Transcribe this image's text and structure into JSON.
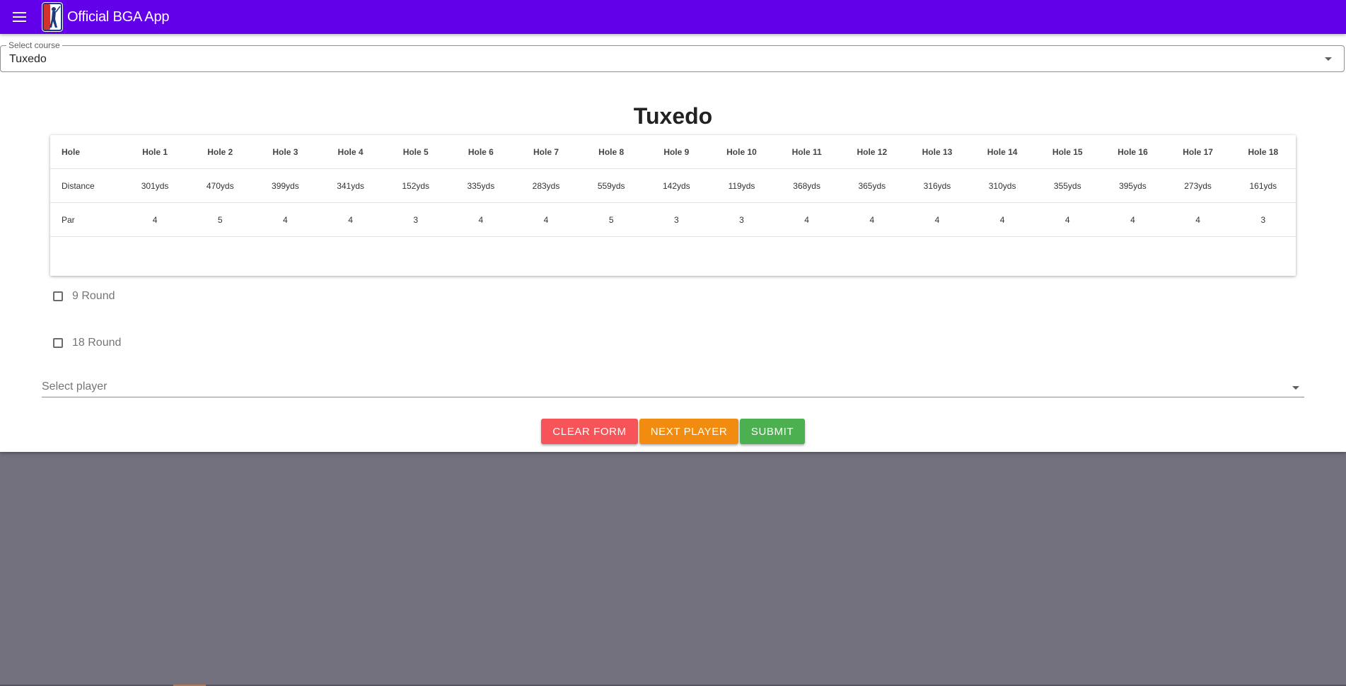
{
  "app": {
    "title": "Official BGA App",
    "theme_color": "#6200ea",
    "background_color": "#72707d",
    "logo": "golfer-logo-icon",
    "menu_icon": "hamburger-menu-icon"
  },
  "course_select": {
    "label": "Select course",
    "value": "Tuxedo"
  },
  "course": {
    "name": "Tuxedo",
    "scorecard": {
      "row_labels": [
        "Hole",
        "Distance",
        "Par"
      ],
      "holes": [
        "Hole 1",
        "Hole 2",
        "Hole 3",
        "Hole 4",
        "Hole 5",
        "Hole 6",
        "Hole 7",
        "Hole 8",
        "Hole 9",
        "Hole 10",
        "Hole 11",
        "Hole 12",
        "Hole 13",
        "Hole 14",
        "Hole 15",
        "Hole 16",
        "Hole 17",
        "Hole 18"
      ],
      "distances": [
        "301yds",
        "470yds",
        "399yds",
        "341yds",
        "152yds",
        "335yds",
        "283yds",
        "559yds",
        "142yds",
        "119yds",
        "368yds",
        "365yds",
        "316yds",
        "310yds",
        "355yds",
        "395yds",
        "273yds",
        "161yds"
      ],
      "pars": [
        "4",
        "5",
        "4",
        "4",
        "3",
        "4",
        "4",
        "5",
        "3",
        "3",
        "4",
        "4",
        "4",
        "4",
        "4",
        "4",
        "4",
        "3"
      ]
    }
  },
  "round_options": [
    {
      "label": "9 Round",
      "checked": false
    },
    {
      "label": "18 Round",
      "checked": false
    }
  ],
  "player_select": {
    "placeholder": "Select player",
    "value": ""
  },
  "actions": {
    "clear": {
      "label": "CLEAR FORM",
      "color": "#f75459"
    },
    "next": {
      "label": "NEXT PLAYER",
      "color": "#f28c10"
    },
    "submit": {
      "label": "SUBMIT",
      "color": "#4caf50"
    }
  }
}
